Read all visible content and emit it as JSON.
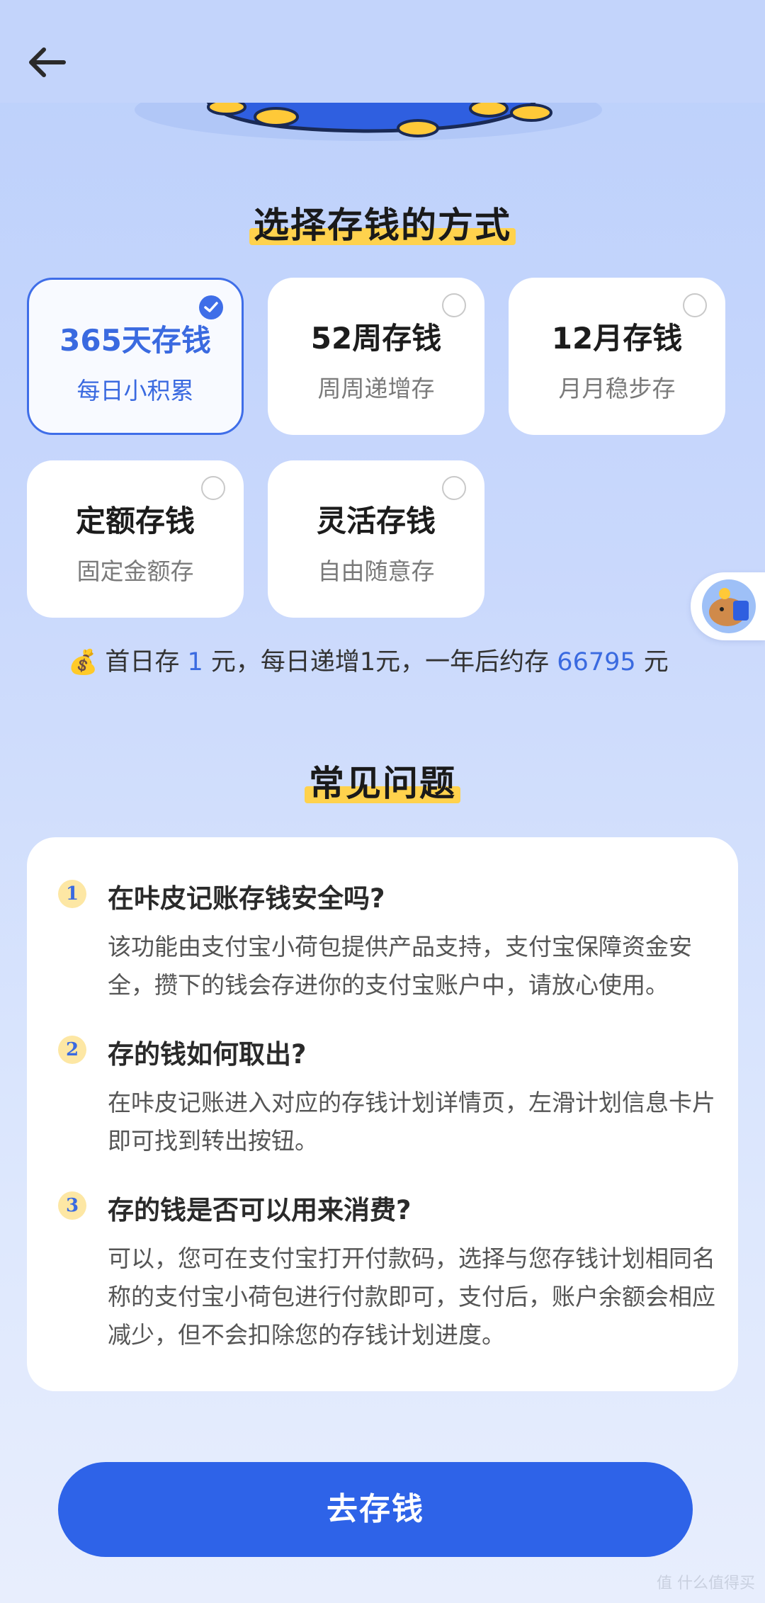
{
  "section1": {
    "title": "选择存钱的方式"
  },
  "options": [
    {
      "title": "365天存钱",
      "subtitle": "每日小积累",
      "selected": true
    },
    {
      "title": "52周存钱",
      "subtitle": "周周递增存",
      "selected": false
    },
    {
      "title": "12月存钱",
      "subtitle": "月月稳步存",
      "selected": false
    },
    {
      "title": "定额存钱",
      "subtitle": "固定金额存",
      "selected": false
    },
    {
      "title": "灵活存钱",
      "subtitle": "自由随意存",
      "selected": false
    }
  ],
  "summary": {
    "icon": "money-bag-icon",
    "part1": "首日存 ",
    "first_amount": "1",
    "part2": " 元，每日递增1元，一年后约存 ",
    "total_amount": "66795",
    "part3": " 元"
  },
  "section2": {
    "title": "常见问题"
  },
  "faq": [
    {
      "num": "1",
      "question": "在咔皮记账存钱安全吗?",
      "answer": "该功能由支付宝小荷包提供产品支持，支付宝保障资金安全，攒下的钱会存进你的支付宝账户中，请放心使用。"
    },
    {
      "num": "2",
      "question": "存的钱如何取出?",
      "answer": "在咔皮记账进入对应的存钱计划详情页，左滑计划信息卡片即可找到转出按钮。"
    },
    {
      "num": "3",
      "question": "存的钱是否可以用来消费?",
      "answer": "可以，您可在支付宝打开付款码，选择与您存钱计划相同名称的支付宝小荷包进行付款即可，支付后，账户余额会相应减少，但不会扣除您的存钱计划进度。"
    }
  ],
  "cta": {
    "label": "去存钱"
  },
  "watermark": "值 什么值得买",
  "colors": {
    "accent": "#2e63e8",
    "highlight": "#ffd24d"
  }
}
